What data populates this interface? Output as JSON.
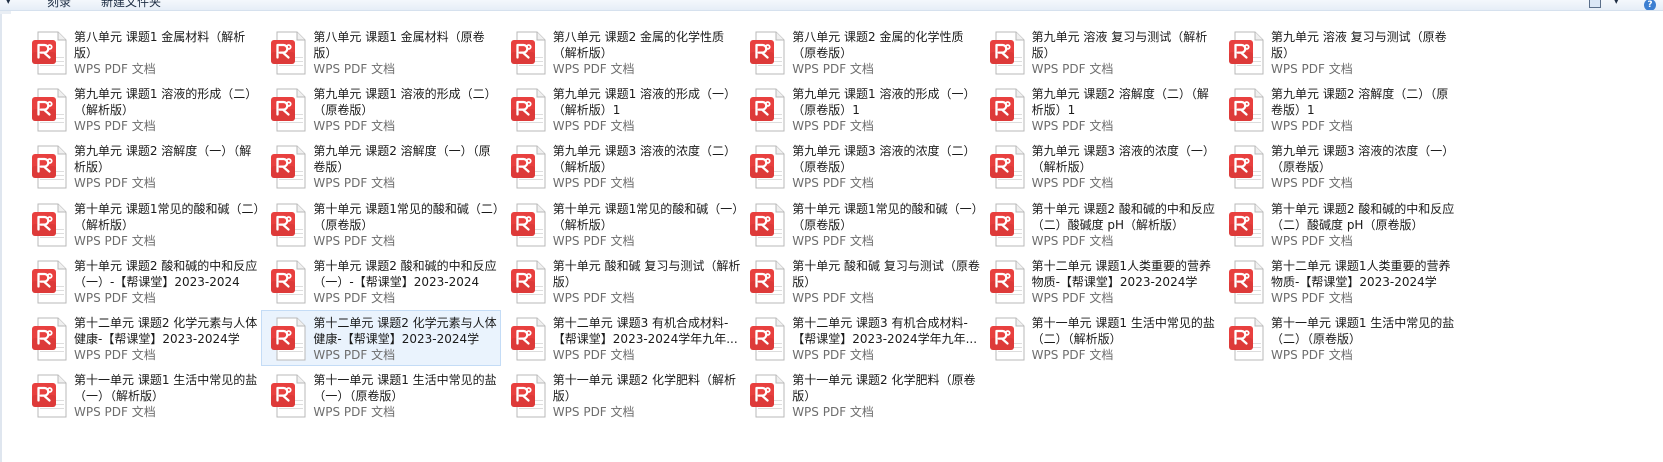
{
  "toolbar": {
    "dropdown_glyph": "▾",
    "burn_label": "刻录",
    "new_folder_label": "新建文件夹",
    "view_icon": "view-options-icon",
    "view_caret": "▾",
    "help_icon": "help-icon"
  },
  "colors": {
    "pdf_red": "#e8403f",
    "pdf_red_dark": "#c8302f",
    "selection_fill": "#eaf3fd",
    "selection_border": "#c4dcf6"
  },
  "files": [
    {
      "name": "第八单元 课题1 金属材料（解析版）",
      "type": "WPS PDF 文档"
    },
    {
      "name": "第八单元 课题1 金属材料（原卷版）",
      "type": "WPS PDF 文档"
    },
    {
      "name": "第八单元 课题2 金属的化学性质（解析版）",
      "type": "WPS PDF 文档"
    },
    {
      "name": "第八单元 课题2 金属的化学性质（原卷版）",
      "type": "WPS PDF 文档"
    },
    {
      "name": "第九单元 溶液 复习与测试（解析版）",
      "type": "WPS PDF 文档"
    },
    {
      "name": "第九单元 溶液 复习与测试（原卷版）",
      "type": "WPS PDF 文档"
    },
    {
      "name": "第九单元 课题1 溶液的形成（二）（解析版）",
      "type": "WPS PDF 文档"
    },
    {
      "name": "第九单元 课题1 溶液的形成（二）（原卷版）",
      "type": "WPS PDF 文档"
    },
    {
      "name": "第九单元 课题1 溶液的形成（一）（解析版）1",
      "type": "WPS PDF 文档"
    },
    {
      "name": "第九单元 课题1 溶液的形成（一）（原卷版）1",
      "type": "WPS PDF 文档"
    },
    {
      "name": "第九单元 课题2 溶解度（二）（解析版）1",
      "type": "WPS PDF 文档"
    },
    {
      "name": "第九单元 课题2 溶解度（二）（原卷版）1",
      "type": "WPS PDF 文档"
    },
    {
      "name": "第九单元 课题2 溶解度（一）（解析版）",
      "type": "WPS PDF 文档"
    },
    {
      "name": "第九单元 课题2 溶解度（一）（原卷版）",
      "type": "WPS PDF 文档"
    },
    {
      "name": "第九单元 课题3 溶液的浓度（二）（解析版）",
      "type": "WPS PDF 文档"
    },
    {
      "name": "第九单元 课题3 溶液的浓度（二）（原卷版）",
      "type": "WPS PDF 文档"
    },
    {
      "name": "第九单元 课题3 溶液的浓度（一）（解析版）",
      "type": "WPS PDF 文档"
    },
    {
      "name": "第九单元 课题3 溶液的浓度（一）（原卷版）",
      "type": "WPS PDF 文档"
    },
    {
      "name": "第十单元 课题1常见的酸和碱（二）（解析版）",
      "type": "WPS PDF 文档"
    },
    {
      "name": "第十单元 课题1常见的酸和碱（二）（原卷版）",
      "type": "WPS PDF 文档"
    },
    {
      "name": "第十单元 课题1常见的酸和碱（一）（解析版）",
      "type": "WPS PDF 文档"
    },
    {
      "name": "第十单元 课题1常见的酸和碱（一）（原卷版）",
      "type": "WPS PDF 文档"
    },
    {
      "name": "第十单元 课题2 酸和碱的中和反应（二）酸碱度 pH（解析版）",
      "type": "WPS PDF 文档"
    },
    {
      "name": "第十单元 课题2 酸和碱的中和反应（二）酸碱度 pH（原卷版）",
      "type": "WPS PDF 文档"
    },
    {
      "name": "第十单元 课题2 酸和碱的中和反应（一）-【帮课堂】2023-2024学...",
      "type": "WPS PDF 文档"
    },
    {
      "name": "第十单元 课题2 酸和碱的中和反应（一）-【帮课堂】2023-2024学...",
      "type": "WPS PDF 文档"
    },
    {
      "name": "第十单元 酸和碱 复习与测试（解析版）",
      "type": "WPS PDF 文档"
    },
    {
      "name": "第十单元 酸和碱 复习与测试（原卷版）",
      "type": "WPS PDF 文档"
    },
    {
      "name": "第十二单元 课题1人类重要的营养物质-【帮课堂】2023-2024学年...",
      "type": "WPS PDF 文档"
    },
    {
      "name": "第十二单元 课题1人类重要的营养物质-【帮课堂】2023-2024学年...",
      "type": "WPS PDF 文档"
    },
    {
      "name": "第十二单元 课题2 化学元素与人体健康-【帮课堂】2023-2024学年...",
      "type": "WPS PDF 文档"
    },
    {
      "name": "第十二单元 课题2 化学元素与人体健康-【帮课堂】2023-2024学年...",
      "type": "WPS PDF 文档",
      "selected": true
    },
    {
      "name": "第十二单元 课题3 有机合成材料-【帮课堂】2023-2024学年九年...",
      "type": "WPS PDF 文档"
    },
    {
      "name": "第十二单元 课题3 有机合成材料-【帮课堂】2023-2024学年九年...",
      "type": "WPS PDF 文档"
    },
    {
      "name": "第十一单元 课题1 生活中常见的盐（二）（解析版）",
      "type": "WPS PDF 文档"
    },
    {
      "name": "第十一单元 课题1 生活中常见的盐（二）（原卷版）",
      "type": "WPS PDF 文档"
    },
    {
      "name": "第十一单元 课题1 生活中常见的盐（一）（解析版）",
      "type": "WPS PDF 文档"
    },
    {
      "name": "第十一单元 课题1 生活中常见的盐（一）（原卷版）",
      "type": "WPS PDF 文档"
    },
    {
      "name": "第十一单元 课题2 化学肥料（解析版）",
      "type": "WPS PDF 文档"
    },
    {
      "name": "第十一单元 课题2 化学肥料（原卷版）",
      "type": "WPS PDF 文档"
    }
  ]
}
